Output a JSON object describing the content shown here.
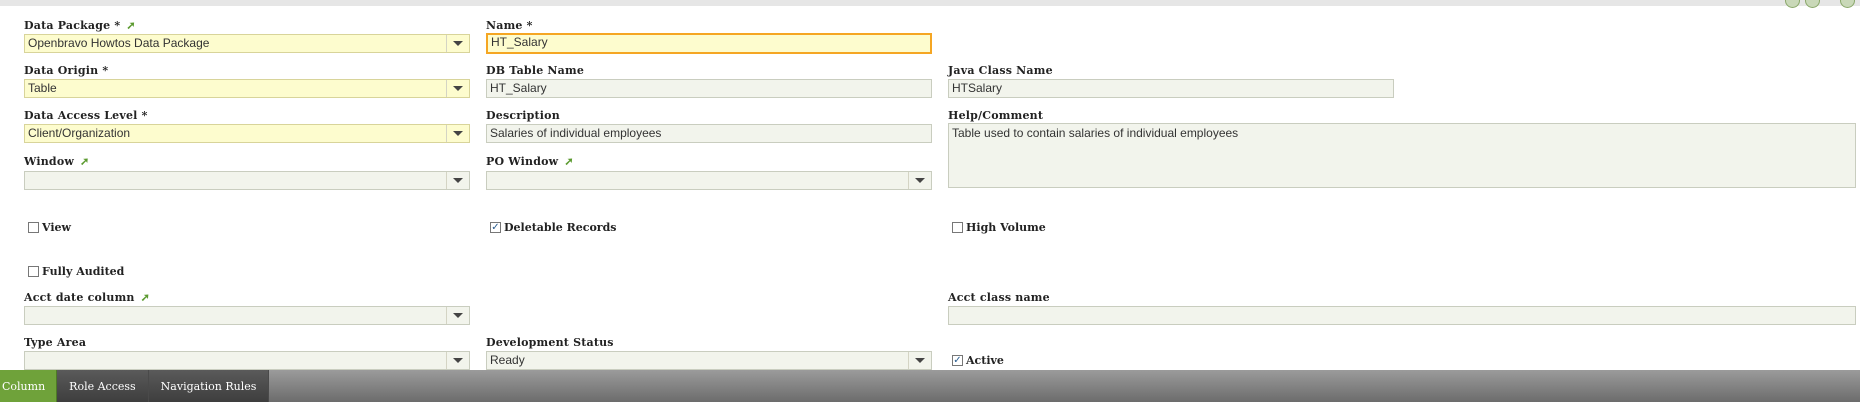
{
  "fields": {
    "data_package": {
      "label": "Data Package *",
      "value": "Openbravo Howtos Data Package"
    },
    "name": {
      "label": "Name *",
      "value": "HT_Salary"
    },
    "data_origin": {
      "label": "Data Origin *",
      "value": "Table"
    },
    "db_table_name": {
      "label": "DB Table Name",
      "value": "HT_Salary"
    },
    "java_class_name": {
      "label": "Java Class Name",
      "value": "HTSalary"
    },
    "data_access_level": {
      "label": "Data Access Level *",
      "value": "Client/Organization"
    },
    "description": {
      "label": "Description",
      "value": "Salaries of individual employees"
    },
    "help_comment": {
      "label": "Help/Comment",
      "value": "Table used to contain salaries of individual employees"
    },
    "window": {
      "label": "Window",
      "value": ""
    },
    "po_window": {
      "label": "PO Window",
      "value": ""
    },
    "acct_date_column": {
      "label": "Acct date column",
      "value": ""
    },
    "acct_class_name": {
      "label": "Acct class name",
      "value": ""
    },
    "type_area": {
      "label": "Type Area",
      "value": ""
    },
    "development_status": {
      "label": "Development Status",
      "value": "Ready"
    }
  },
  "checkboxes": {
    "view": {
      "label": "View",
      "checked": false
    },
    "deletable_records": {
      "label": "Deletable Records",
      "checked": true
    },
    "high_volume": {
      "label": "High Volume",
      "checked": false
    },
    "fully_audited": {
      "label": "Fully Audited",
      "checked": false
    },
    "active": {
      "label": "Active",
      "checked": true
    }
  },
  "check_mark": "✓",
  "link_arrow": "➚",
  "tabs": [
    {
      "label": "Column",
      "active": true
    },
    {
      "label": "Role Access",
      "active": false
    },
    {
      "label": "Navigation Rules",
      "active": false
    }
  ],
  "colors": {
    "required_bg": "#fdfcce",
    "focus_border": "#f5a623",
    "active_tab": "#6fa23a"
  }
}
